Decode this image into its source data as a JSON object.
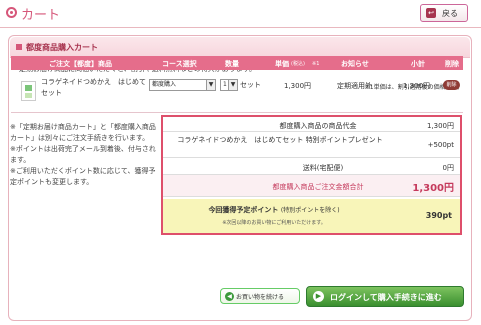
{
  "header": {
    "title": "カート",
    "back_label": "戻る",
    "back_icon": "back-arrow-icon"
  },
  "section": {
    "title": "都度商品購入カート"
  },
  "notice": "定期お届け商品に同梱いただくと、割引や送料無料などの特典があります。",
  "unit_note": "※1単価は、割引適用後の価格です。",
  "table": {
    "headers": [
      "ご注文【都度】商品",
      "コース選択",
      "数量",
      "単価",
      "(税込)",
      "※1",
      "お知らせ",
      "小計",
      "削除"
    ],
    "row": {
      "name": "コラゲネイドつめかえ　はじめてセット",
      "course": "都度購入",
      "qty": "1",
      "qty_unit": "セット",
      "price": "1,300円",
      "notes": "定期適用外",
      "subtotal": "1,300円",
      "delete_label": "削除"
    }
  },
  "left_notes": [
    "※「定期お届け商品カート」と「都度購入商品カート」は別々にご注文手続きを行います。",
    "※ポイントは出荷完了メール到着後、付与されます。",
    "※ご利用いただくポイント数に応じて、獲得予定ポイントも変更します。"
  ],
  "summary": {
    "rows": [
      {
        "label": "都度購入商品の商品代金",
        "value": "1,300円"
      },
      {
        "label": "コラゲネイドつめかえ　はじめてセット 特別ポイントプレゼント",
        "value": "+500pt"
      },
      {
        "label": "送料(宅配便)",
        "value": "0円"
      },
      {
        "label": "都度購入商品ご注文金額合計",
        "value": "1,300円"
      }
    ],
    "points_label": "今回獲得予定ポイント",
    "points_sub": "(特別ポイントを除く)",
    "points_note": "※次回以降のお買い物にご利用いただけます。",
    "points_value": "390pt"
  },
  "buttons": {
    "continue": "お買い物を続ける",
    "login": "ログインして購入手続きに進む"
  },
  "colors": {
    "accent": "#d6577a",
    "table_header": "#e56d8b",
    "login": "#3a8f2f"
  }
}
